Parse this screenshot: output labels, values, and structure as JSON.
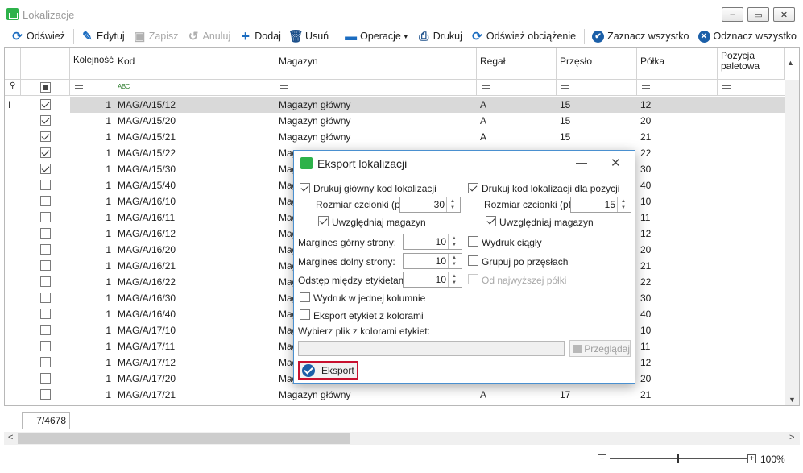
{
  "window": {
    "title": "Lokalizacje",
    "minimize": "‒",
    "maximize": "▭",
    "close": "✕"
  },
  "toolbar": {
    "refresh": "Odśwież",
    "edit": "Edytuj",
    "save": "Zapisz",
    "cancel": "Anuluj",
    "add": "Dodaj",
    "delete": "Usuń",
    "operations": "Operacje",
    "print": "Drukuj",
    "refresh_load": "Odśwież obciążenie",
    "select_all": "Zaznacz wszystko",
    "deselect_all": "Odznacz wszystko"
  },
  "grid": {
    "columns": [
      "Kolejność",
      "Kod",
      "Magazyn",
      "Regał",
      "Przęsło",
      "Półka",
      "Pozycja paletowa"
    ],
    "filter_abc": "ABC",
    "rows": [
      {
        "checked": true,
        "order": "1",
        "code": "MAG/A/15/12",
        "warehouse": "Magazyn główny",
        "rack": "A",
        "bay": "15",
        "shelf": "12"
      },
      {
        "checked": true,
        "order": "1",
        "code": "MAG/A/15/20",
        "warehouse": "Magazyn główny",
        "rack": "A",
        "bay": "15",
        "shelf": "20"
      },
      {
        "checked": true,
        "order": "1",
        "code": "MAG/A/15/21",
        "warehouse": "Magazyn główny",
        "rack": "A",
        "bay": "15",
        "shelf": "21"
      },
      {
        "checked": true,
        "order": "1",
        "code": "MAG/A/15/22",
        "warehouse": "Mag",
        "rack": "",
        "bay": "",
        "shelf": "22"
      },
      {
        "checked": true,
        "order": "1",
        "code": "MAG/A/15/30",
        "warehouse": "Mag",
        "rack": "",
        "bay": "",
        "shelf": "30"
      },
      {
        "checked": false,
        "order": "1",
        "code": "MAG/A/15/40",
        "warehouse": "Mag",
        "rack": "",
        "bay": "",
        "shelf": "40"
      },
      {
        "checked": false,
        "order": "1",
        "code": "MAG/A/16/10",
        "warehouse": "Mag",
        "rack": "",
        "bay": "",
        "shelf": "10"
      },
      {
        "checked": false,
        "order": "1",
        "code": "MAG/A/16/11",
        "warehouse": "Mag",
        "rack": "",
        "bay": "",
        "shelf": "11"
      },
      {
        "checked": false,
        "order": "1",
        "code": "MAG/A/16/12",
        "warehouse": "Mag",
        "rack": "",
        "bay": "",
        "shelf": "12"
      },
      {
        "checked": false,
        "order": "1",
        "code": "MAG/A/16/20",
        "warehouse": "Mag",
        "rack": "",
        "bay": "",
        "shelf": "20"
      },
      {
        "checked": false,
        "order": "1",
        "code": "MAG/A/16/21",
        "warehouse": "Mag",
        "rack": "",
        "bay": "",
        "shelf": "21"
      },
      {
        "checked": false,
        "order": "1",
        "code": "MAG/A/16/22",
        "warehouse": "Mag",
        "rack": "",
        "bay": "",
        "shelf": "22"
      },
      {
        "checked": false,
        "order": "1",
        "code": "MAG/A/16/30",
        "warehouse": "Mag",
        "rack": "",
        "bay": "",
        "shelf": "30"
      },
      {
        "checked": false,
        "order": "1",
        "code": "MAG/A/16/40",
        "warehouse": "Mag",
        "rack": "",
        "bay": "",
        "shelf": "40"
      },
      {
        "checked": false,
        "order": "1",
        "code": "MAG/A/17/10",
        "warehouse": "Mag",
        "rack": "",
        "bay": "",
        "shelf": "10"
      },
      {
        "checked": false,
        "order": "1",
        "code": "MAG/A/17/11",
        "warehouse": "Mag",
        "rack": "",
        "bay": "",
        "shelf": "11"
      },
      {
        "checked": false,
        "order": "1",
        "code": "MAG/A/17/12",
        "warehouse": "Mag",
        "rack": "",
        "bay": "",
        "shelf": "12"
      },
      {
        "checked": false,
        "order": "1",
        "code": "MAG/A/17/20",
        "warehouse": "Mag",
        "rack": "",
        "bay": "",
        "shelf": "20"
      },
      {
        "checked": false,
        "order": "1",
        "code": "MAG/A/17/21",
        "warehouse": "Magazyn główny",
        "rack": "A",
        "bay": "17",
        "shelf": "21"
      }
    ]
  },
  "status": {
    "counter": "7/4678",
    "zoom": "100%"
  },
  "dialog": {
    "title": "Eksport lokalizacji",
    "print_main_code": "Drukuj główny kod lokalizacji",
    "print_position_code": "Drukuj kod lokalizacji dla pozycji",
    "font_size_label": "Rozmiar czcionki (pt):",
    "font_size_left": "30",
    "font_size_right": "15",
    "include_warehouse": "Uwzględniaj magazyn",
    "margin_top_label": "Margines górny strony:",
    "margin_top": "10",
    "margin_bottom_label": "Margines dolny strony:",
    "margin_bottom": "10",
    "label_spacing_label": "Odstęp między etykietami:",
    "label_spacing": "10",
    "continuous_print": "Wydruk ciągły",
    "group_by_bays": "Grupuj po przęsłach",
    "from_highest_shelf": "Od najwyższej półki",
    "single_column": "Wydruk w jednej kolumnie",
    "export_colors": "Eksport etykiet z kolorami",
    "choose_file_label": "Wybierz plik z kolorami etykiet:",
    "file_path": "",
    "browse": "Przeglądaj",
    "export": "Eksport"
  }
}
